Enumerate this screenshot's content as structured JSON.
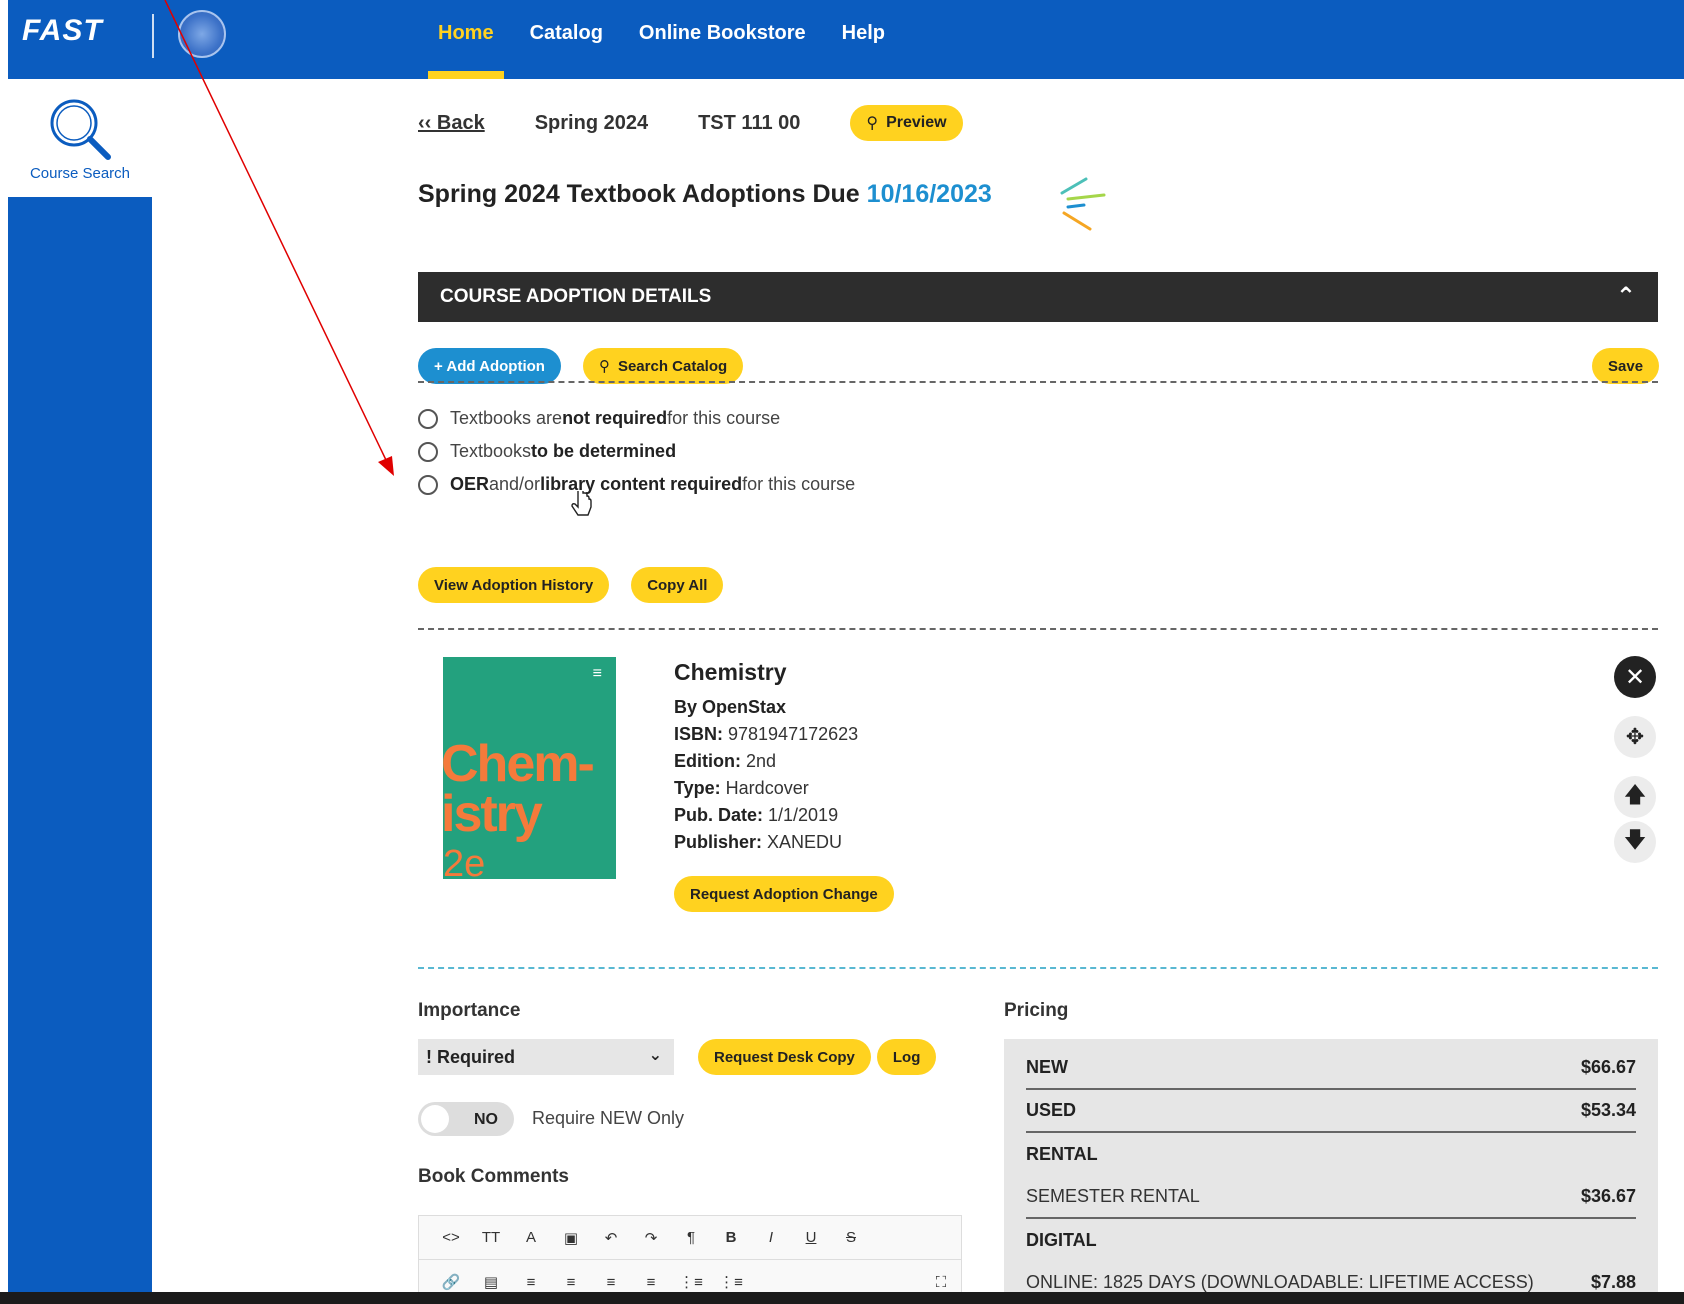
{
  "header": {
    "logo": "FAST",
    "nav": [
      "Home",
      "Catalog",
      "Online Bookstore",
      "Help"
    ],
    "active_nav": "Home"
  },
  "sidebar": {
    "item_label": "Course Search",
    "icon": "search-icon"
  },
  "crumbs": {
    "back": "‹‹ Back",
    "term": "Spring 2024",
    "course": "TST 111 00",
    "preview": "Preview"
  },
  "headline": {
    "prefix": "Spring 2024 Textbook Adoptions Due ",
    "date": "10/16/2023"
  },
  "section": {
    "title": "COURSE ADOPTION DETAILS"
  },
  "actions": {
    "add_adoption": "+ Add Adoption",
    "search_catalog": "Search Catalog",
    "save": "Save",
    "view_history": "View Adoption History",
    "copy_all": "Copy All"
  },
  "options": {
    "not_required_a": "Textbooks are ",
    "not_required_b": "not required",
    "not_required_c": " for this course",
    "tbd_a": "Textbooks ",
    "tbd_b": "to be determined",
    "oer_a": "OER",
    "oer_b": " and/or ",
    "oer_c": "library content required",
    "oer_d": " for this course"
  },
  "book": {
    "cover_text": "Chem-\nistry",
    "cover_edition": "2e",
    "title": "Chemistry",
    "author": "By OpenStax",
    "isbn_label": "ISBN:",
    "isbn": " 9781947172623",
    "edition_label": "Edition:",
    "edition": " 2nd",
    "type_label": "Type:",
    "type": " Hardcover",
    "pubdate_label": "Pub. Date:",
    "pubdate": " 1/1/2019",
    "publisher_label": "Publisher:",
    "publisher": " XANEDU",
    "request_change": "Request Adoption Change"
  },
  "importance": {
    "label": "Importance",
    "selected": "! Required",
    "desk_copy": "Request Desk Copy",
    "log": "Log",
    "toggle_state": "NO",
    "toggle_label": "Require NEW Only",
    "comments_label": "Book Comments"
  },
  "pricing": {
    "label": "Pricing",
    "new_label": "NEW",
    "new_price": "$66.67",
    "used_label": "USED",
    "used_price": "$53.34",
    "rental_label": "RENTAL",
    "semester_label": "SEMESTER RENTAL",
    "semester_price": "$36.67",
    "digital_label": "DIGITAL",
    "online_label": "ONLINE: 1825 DAYS (DOWNLOADABLE: LIFETIME ACCESS)",
    "online_price": "$7.88"
  },
  "colors": {
    "brand_blue": "#0b5cbf",
    "accent_yellow": "#ffd21f",
    "link_blue": "#1d8fd0",
    "dark_bar": "#2d2d2d"
  }
}
